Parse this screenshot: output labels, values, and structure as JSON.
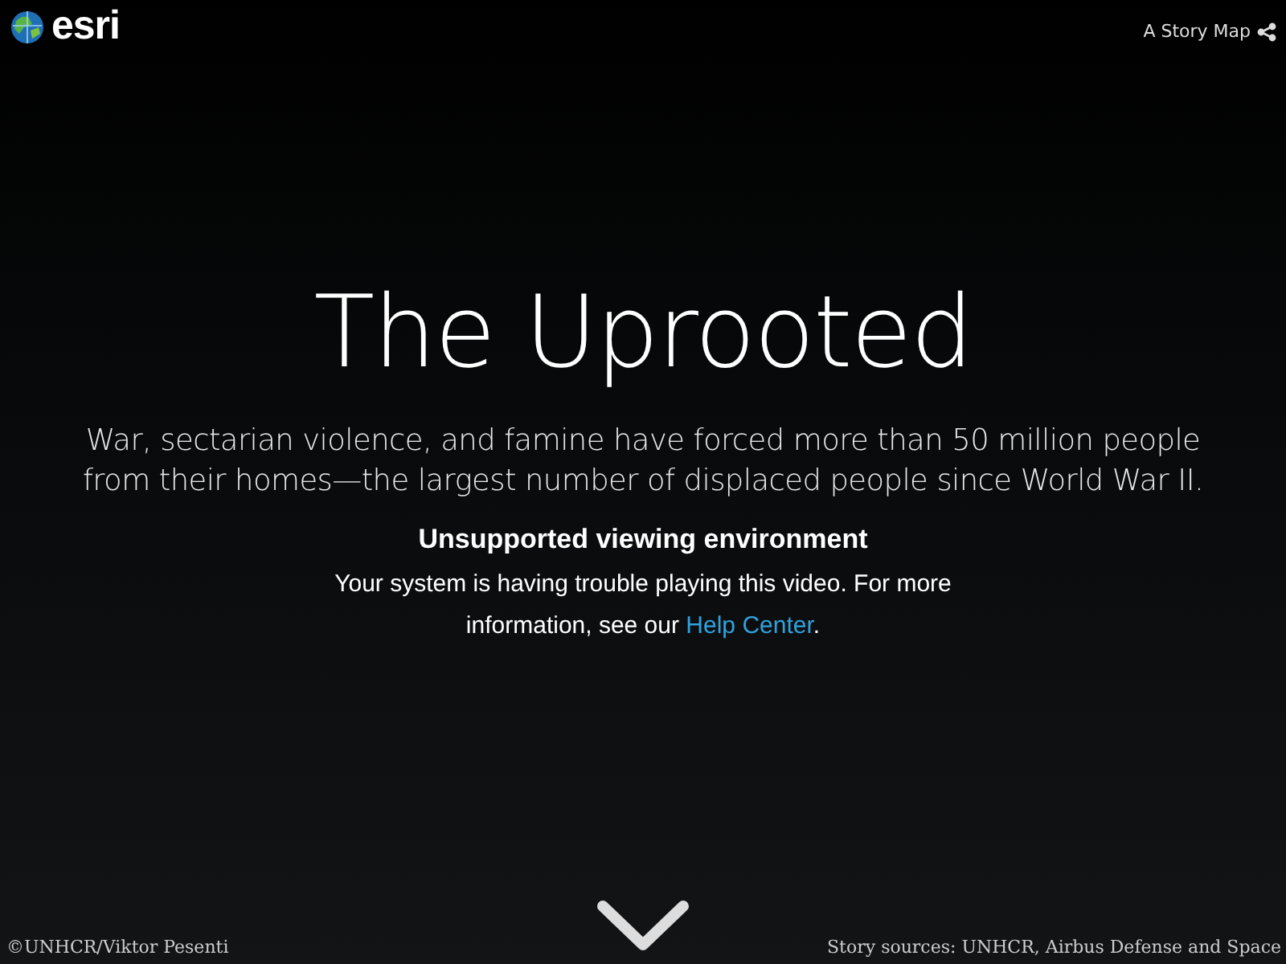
{
  "header": {
    "logo_text": "esri",
    "story_link": "A Story Map"
  },
  "title": "The Uprooted",
  "subtitle": "War, sectarian violence, and famine have forced more than 50 million people from their homes—the largest number of displaced people since World War II.",
  "video_error": {
    "heading": "Unsupported viewing environment",
    "message_before": "Your system is having trouble playing this video. For more information, see our",
    "link": "Help Center",
    "message_after": "."
  },
  "footer": {
    "credit": "©UNHCR/Viktor Pesenti",
    "sources": "Story sources: UNHCR, Airbus Defense and Space"
  }
}
